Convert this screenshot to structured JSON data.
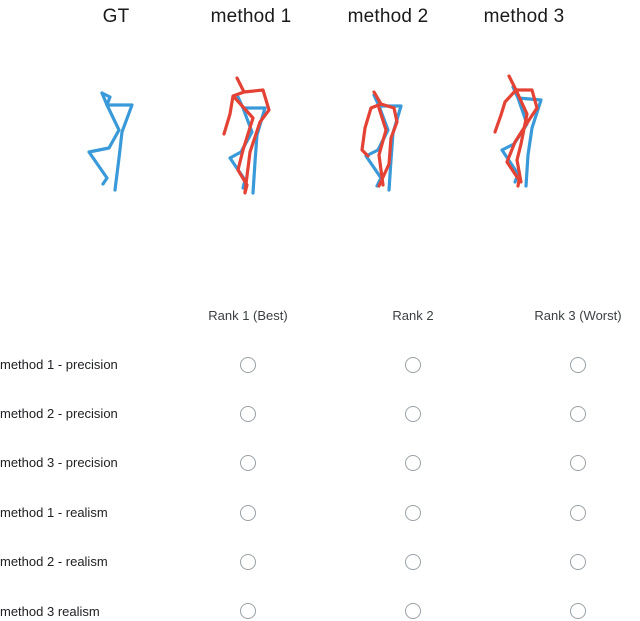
{
  "figure": {
    "titles": [
      "GT",
      "method 1",
      "method 2",
      "method 3"
    ],
    "colors": {
      "gt": "#3a9ad9",
      "pred": "#e34234"
    }
  },
  "ranking": {
    "columns": [
      "Rank 1 (Best)",
      "Rank 2",
      "Rank 3 (Worst)"
    ],
    "rows": [
      "method 1 - precision",
      "method 2 - precision",
      "method 3 - precision",
      "method 1 - realism",
      "method 2 - realism",
      "method 3 realism"
    ]
  }
}
